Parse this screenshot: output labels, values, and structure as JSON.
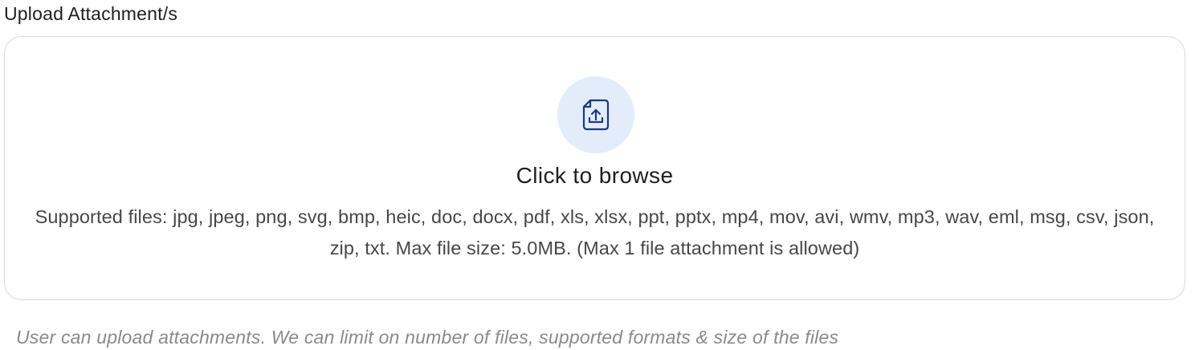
{
  "field": {
    "label": "Upload Attachment/s"
  },
  "dropzone": {
    "icon": "file-upload-icon",
    "browse_label": "Click to browse",
    "supported_text": "Supported files: jpg, jpeg, png, svg, bmp, heic, doc, docx, pdf, xls, xlsx, ppt, pptx, mp4, mov, avi, wmv, mp3, wav, eml, msg, csv, json, zip, txt. Max file size: 5.0MB. (Max 1 file attachment is allowed)"
  },
  "helper_text": "User can upload attachments. We can limit on number of files, supported formats & size of the files",
  "colors": {
    "icon_bg": "#e3ecfa",
    "icon_stroke": "#1e3a78",
    "border": "#d9d9d9",
    "helper": "#8a8a8a"
  }
}
